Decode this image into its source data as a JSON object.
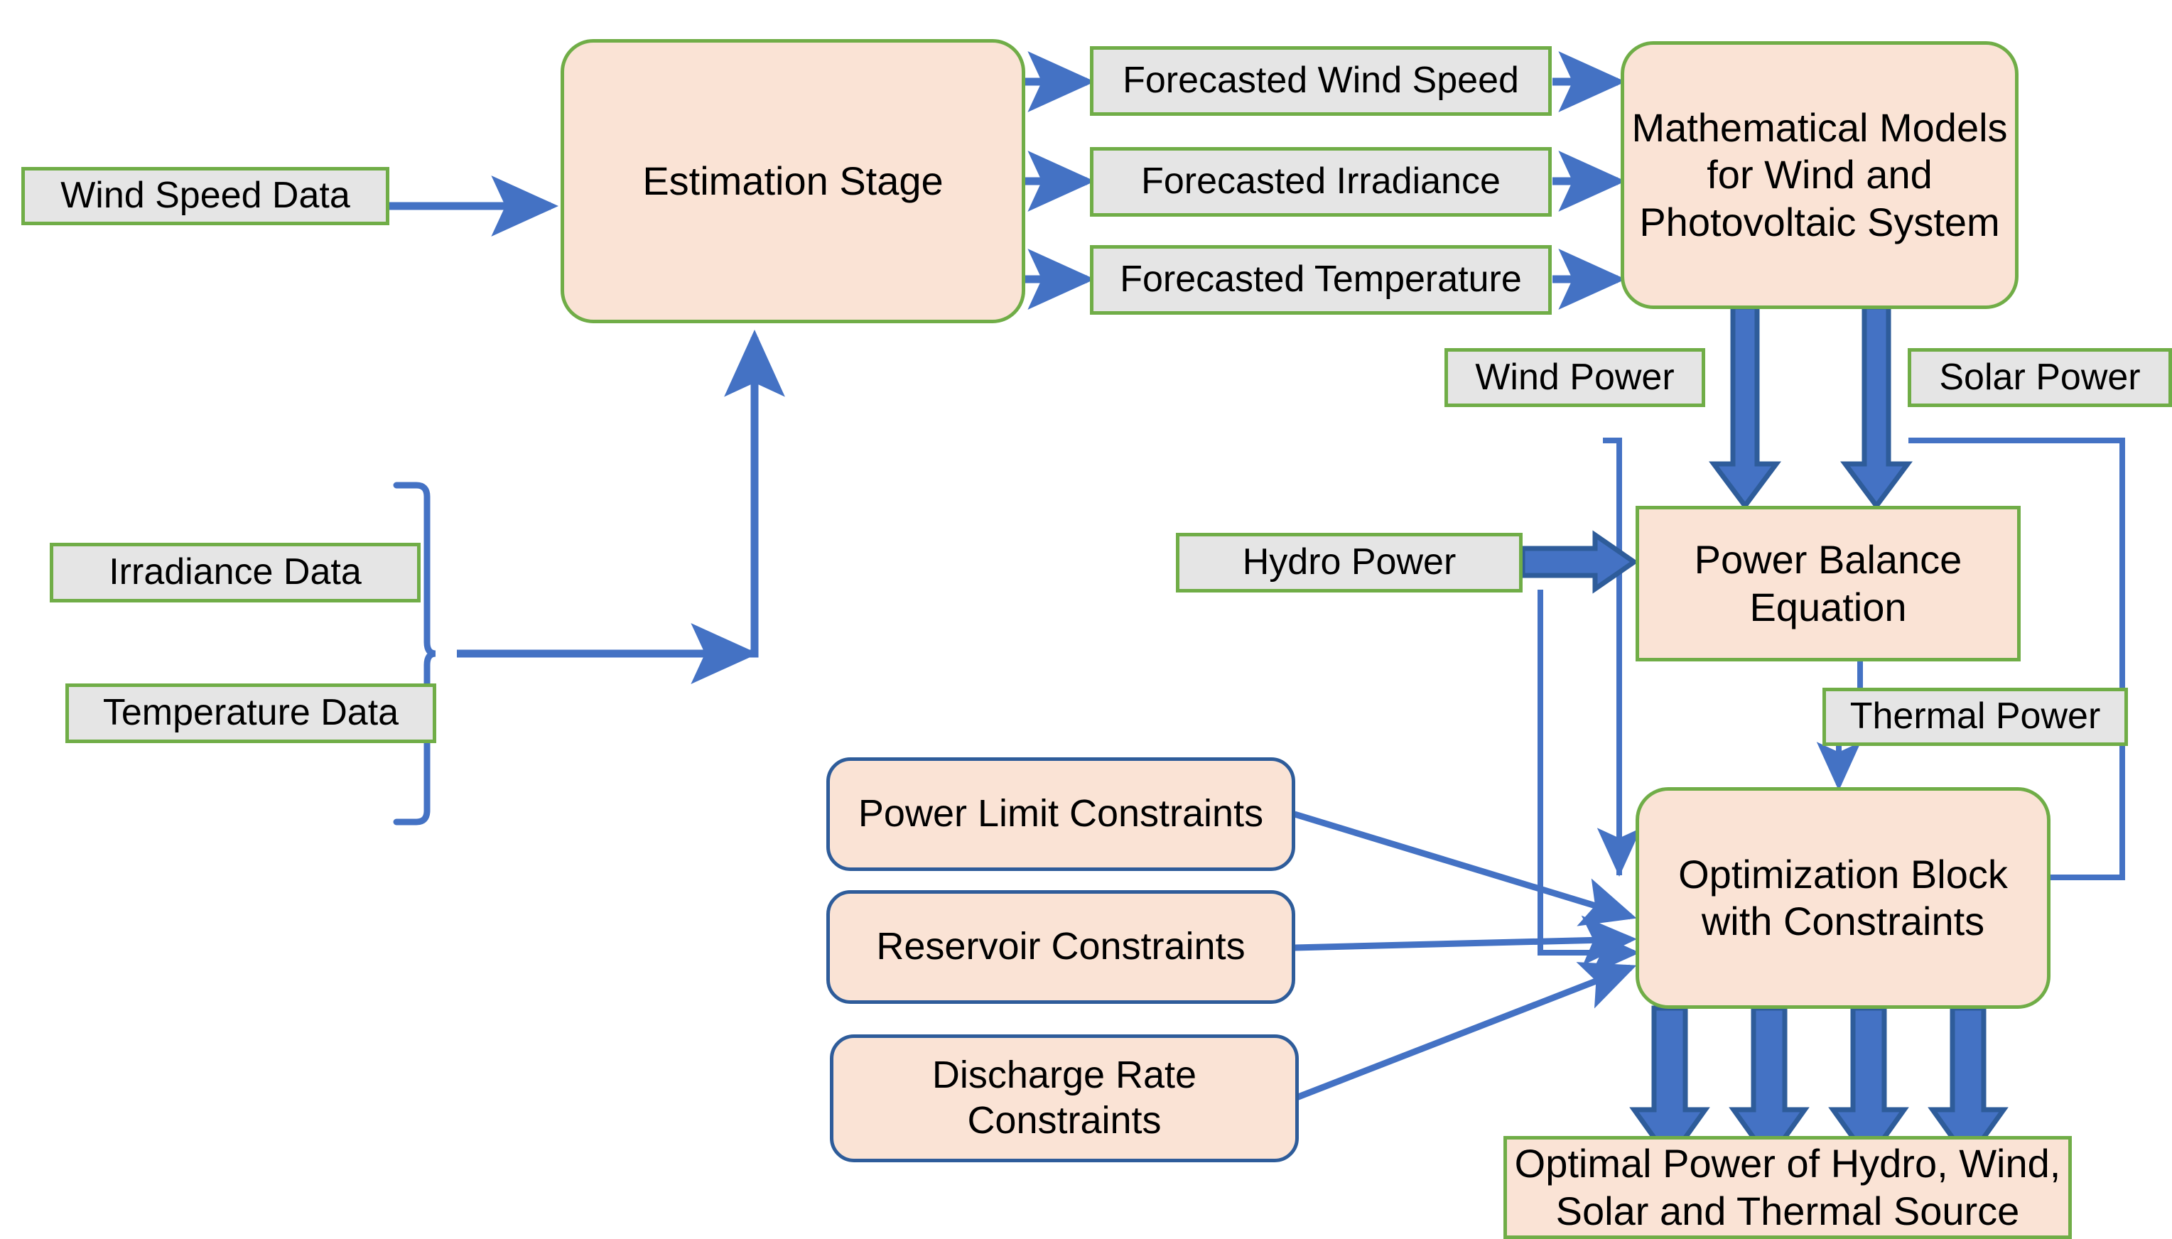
{
  "diagram": {
    "title": "Hydro-Wind-Solar-Thermal Optimal Scheduling Flowchart",
    "colors": {
      "peach_fill": "#FAE3D5",
      "grey_fill": "#E5E5E5",
      "green_border": "#70AD47",
      "blue_border": "#2E5C9A",
      "arrow_blue": "#4472C4",
      "arrow_outline": "#2E5C9A",
      "text": "#000000",
      "background": "#FFFFFF"
    },
    "nodes": {
      "wind_speed_data": "Wind Speed Data",
      "irradiance_data": "Irradiance Data",
      "temperature_data": "Temperature Data",
      "estimation_stage": "Estimation Stage",
      "forecasted_wind_speed": "Forecasted Wind Speed",
      "forecasted_irradiance": "Forecasted Irradiance",
      "forecasted_temperature": "Forecasted Temperature",
      "mathematical_models": "Mathematical Models for Wind and Photovoltaic System",
      "wind_power": "Wind Power",
      "solar_power": "Solar Power",
      "hydro_power": "Hydro Power",
      "power_balance_equation": "Power Balance Equation",
      "thermal_power": "Thermal Power",
      "power_limit_constraints": "Power Limit Constraints",
      "reservoir_constraints": "Reservoir Constraints",
      "discharge_rate_constraints": "Discharge Rate Constraints",
      "optimization_block": "Optimization Block with Constraints",
      "optimal_power_output": "Optimal Power of Hydro, Wind, Solar and Thermal Source"
    },
    "edges": [
      {
        "from": "wind_speed_data",
        "to": "estimation_stage",
        "style": "thin-arrow"
      },
      {
        "from": "irradiance_data",
        "to": "estimation_stage",
        "style": "brace-thin-arrow"
      },
      {
        "from": "temperature_data",
        "to": "estimation_stage",
        "style": "brace-thin-arrow"
      },
      {
        "from": "estimation_stage",
        "to": "forecasted_wind_speed",
        "style": "thin-arrow"
      },
      {
        "from": "estimation_stage",
        "to": "forecasted_irradiance",
        "style": "thin-arrow"
      },
      {
        "from": "estimation_stage",
        "to": "forecasted_temperature",
        "style": "thin-arrow"
      },
      {
        "from": "forecasted_wind_speed",
        "to": "mathematical_models",
        "style": "thin-arrow"
      },
      {
        "from": "forecasted_irradiance",
        "to": "mathematical_models",
        "style": "thin-arrow"
      },
      {
        "from": "forecasted_temperature",
        "to": "mathematical_models",
        "style": "thin-arrow"
      },
      {
        "from": "mathematical_models",
        "to": "power_balance_equation",
        "label": "wind_power",
        "style": "block-arrow"
      },
      {
        "from": "mathematical_models",
        "to": "power_balance_equation",
        "label": "solar_power",
        "style": "block-arrow"
      },
      {
        "from": "hydro_power",
        "to": "power_balance_equation",
        "style": "block-arrow"
      },
      {
        "from": "power_balance_equation",
        "to": "optimization_block",
        "label": "thermal_power",
        "style": "thin-arrow"
      },
      {
        "from": "hydro_power",
        "to": "optimization_block",
        "style": "thin-arrow"
      },
      {
        "from": "wind_power_bus",
        "to": "optimization_block",
        "style": "thin-arrow"
      },
      {
        "from": "solar_power_bus",
        "to": "optimization_block",
        "style": "thin-arrow"
      },
      {
        "from": "power_limit_constraints",
        "to": "optimization_block",
        "style": "thin-arrow"
      },
      {
        "from": "reservoir_constraints",
        "to": "optimization_block",
        "style": "thin-arrow"
      },
      {
        "from": "discharge_rate_constraints",
        "to": "optimization_block",
        "style": "thin-arrow"
      },
      {
        "from": "optimization_block",
        "to": "optimal_power_output",
        "style": "block-arrow",
        "count": 4
      }
    ]
  }
}
